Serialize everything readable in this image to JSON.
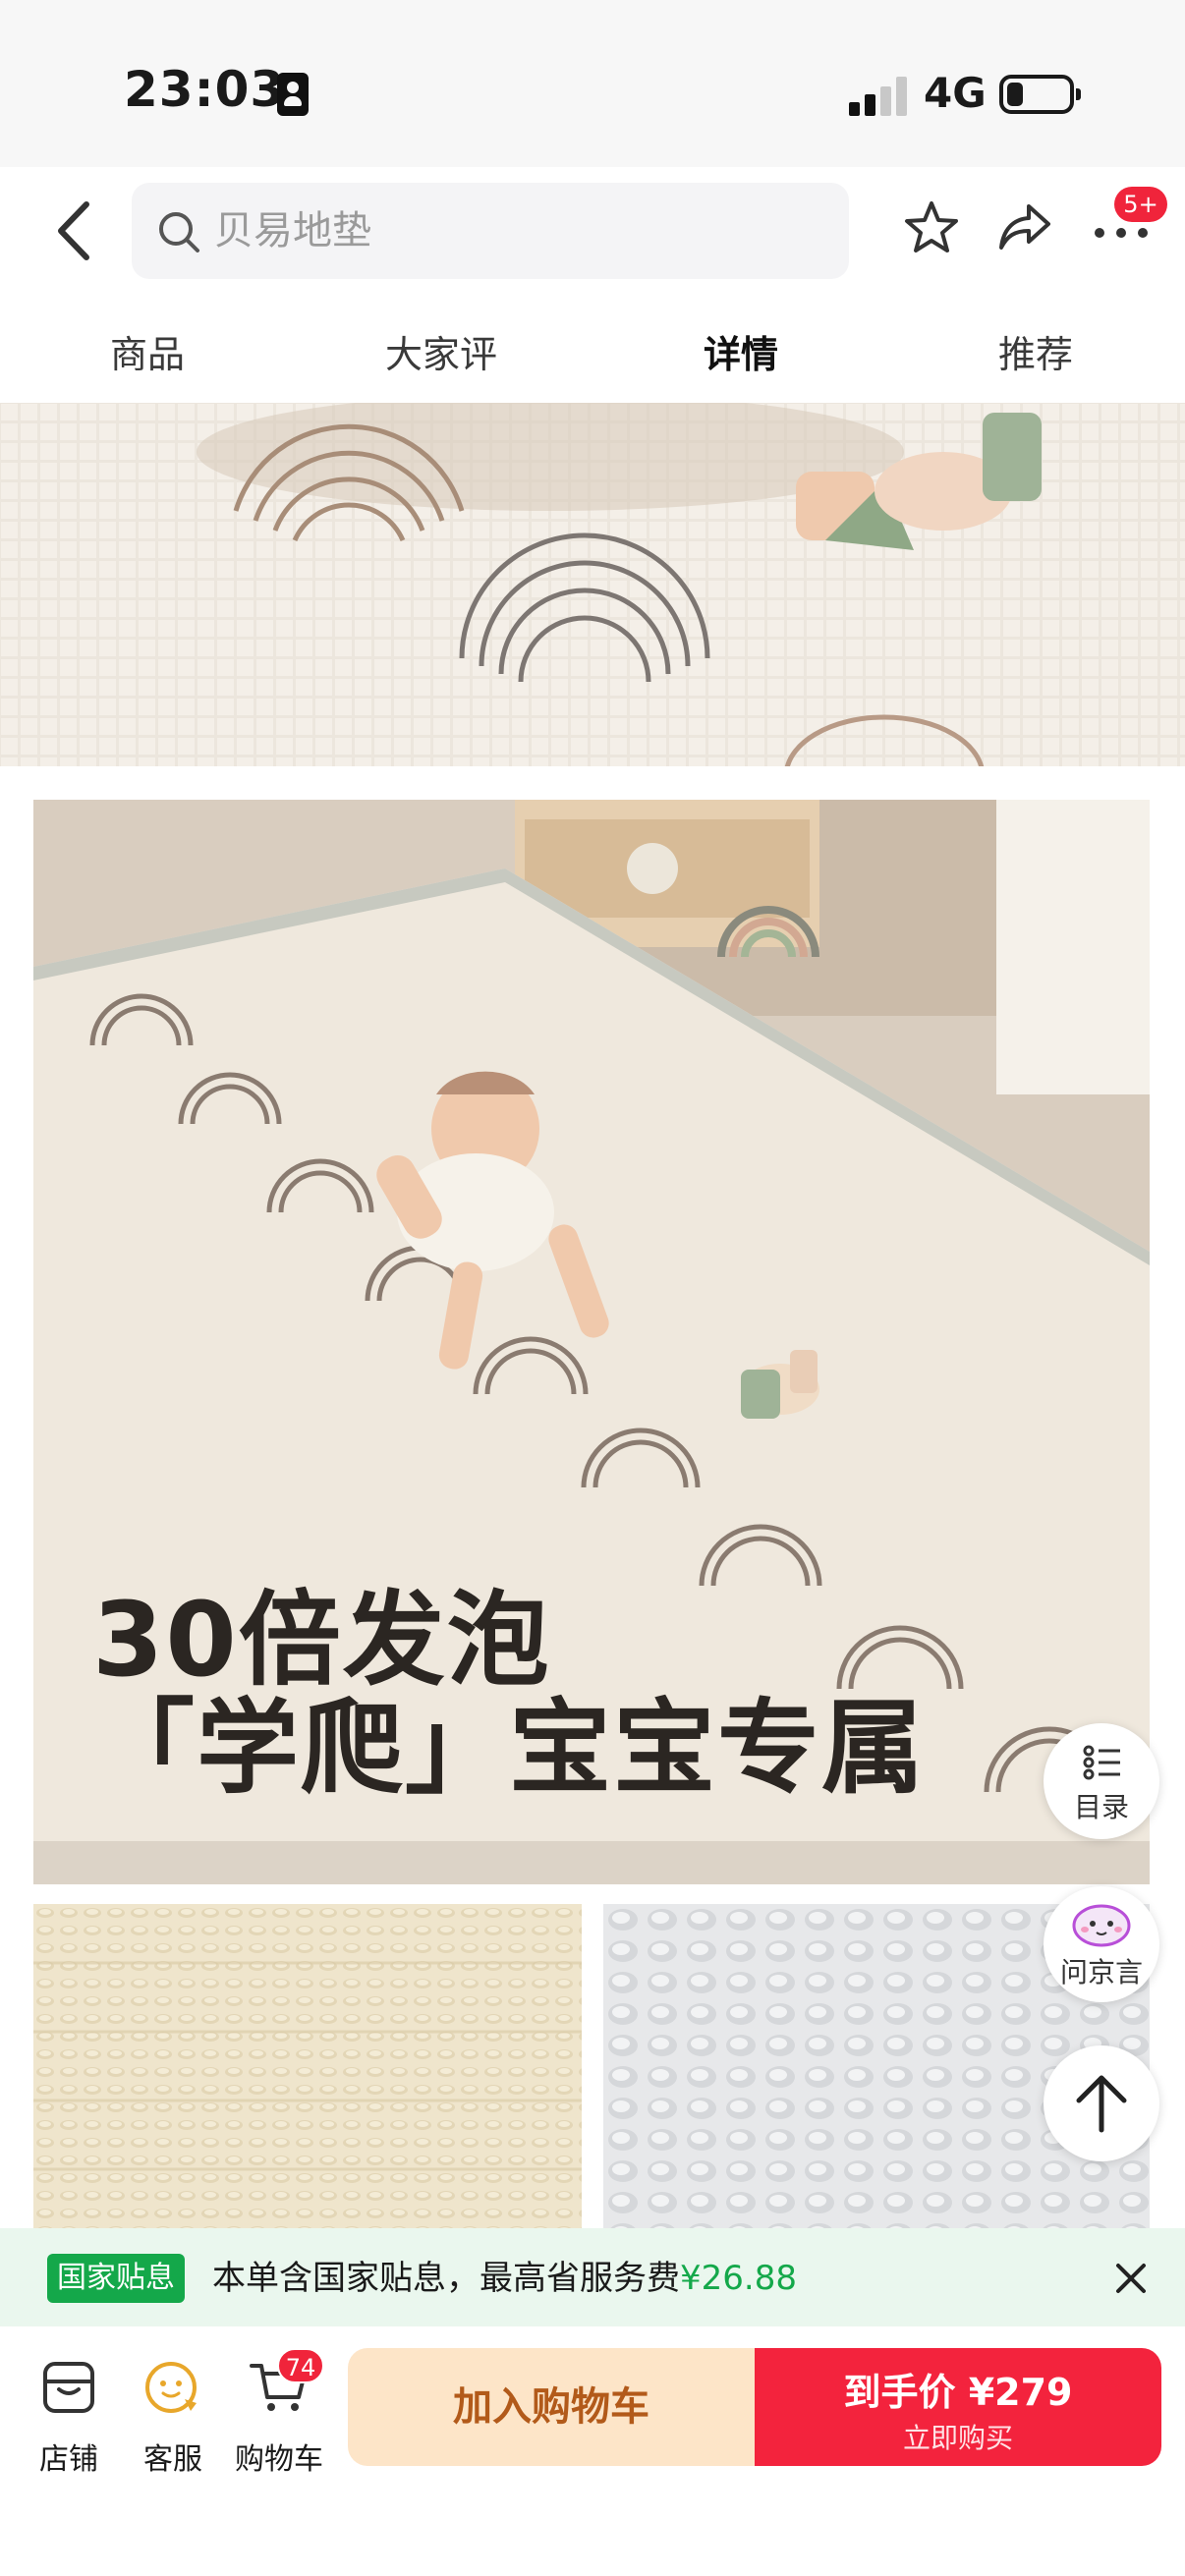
{
  "status_bar": {
    "time": "23:03",
    "network": "4G"
  },
  "header": {
    "search_placeholder": "贝易地垫",
    "more_badge": "5+"
  },
  "tabs": [
    {
      "label": "商品"
    },
    {
      "label": "大家评"
    },
    {
      "label": "详情",
      "active": true
    },
    {
      "label": "推荐"
    }
  ],
  "content": {
    "overlay_line1": "30倍发泡",
    "overlay_line2": "「学爬」宝宝专属"
  },
  "float_buttons": {
    "toc_label": "目录",
    "assistant_label": "问京言"
  },
  "subsidy": {
    "tag": "国家贴息",
    "text": "本单含国家贴息，最高省服务费",
    "amount": "¥26.88"
  },
  "bottom_bar": {
    "store_label": "店铺",
    "service_label": "客服",
    "cart_label": "购物车",
    "cart_badge": "74",
    "add_to_cart": "加入购物车",
    "buy_price": "到手价 ¥279",
    "buy_now": "立即购买"
  },
  "colors": {
    "accent_red": "#f3233d",
    "subsidy_green": "#14a84a",
    "add_cart_bg": "#fde5c8",
    "add_cart_text": "#b25a1a"
  },
  "icons": [
    "sim-card-icon",
    "signal-icon",
    "battery-icon",
    "back-arrow-icon",
    "search-icon",
    "star-icon",
    "share-icon",
    "more-dots-icon",
    "list-icon",
    "assistant-icon",
    "arrow-up-icon",
    "close-icon",
    "store-icon",
    "service-icon",
    "cart-icon"
  ]
}
